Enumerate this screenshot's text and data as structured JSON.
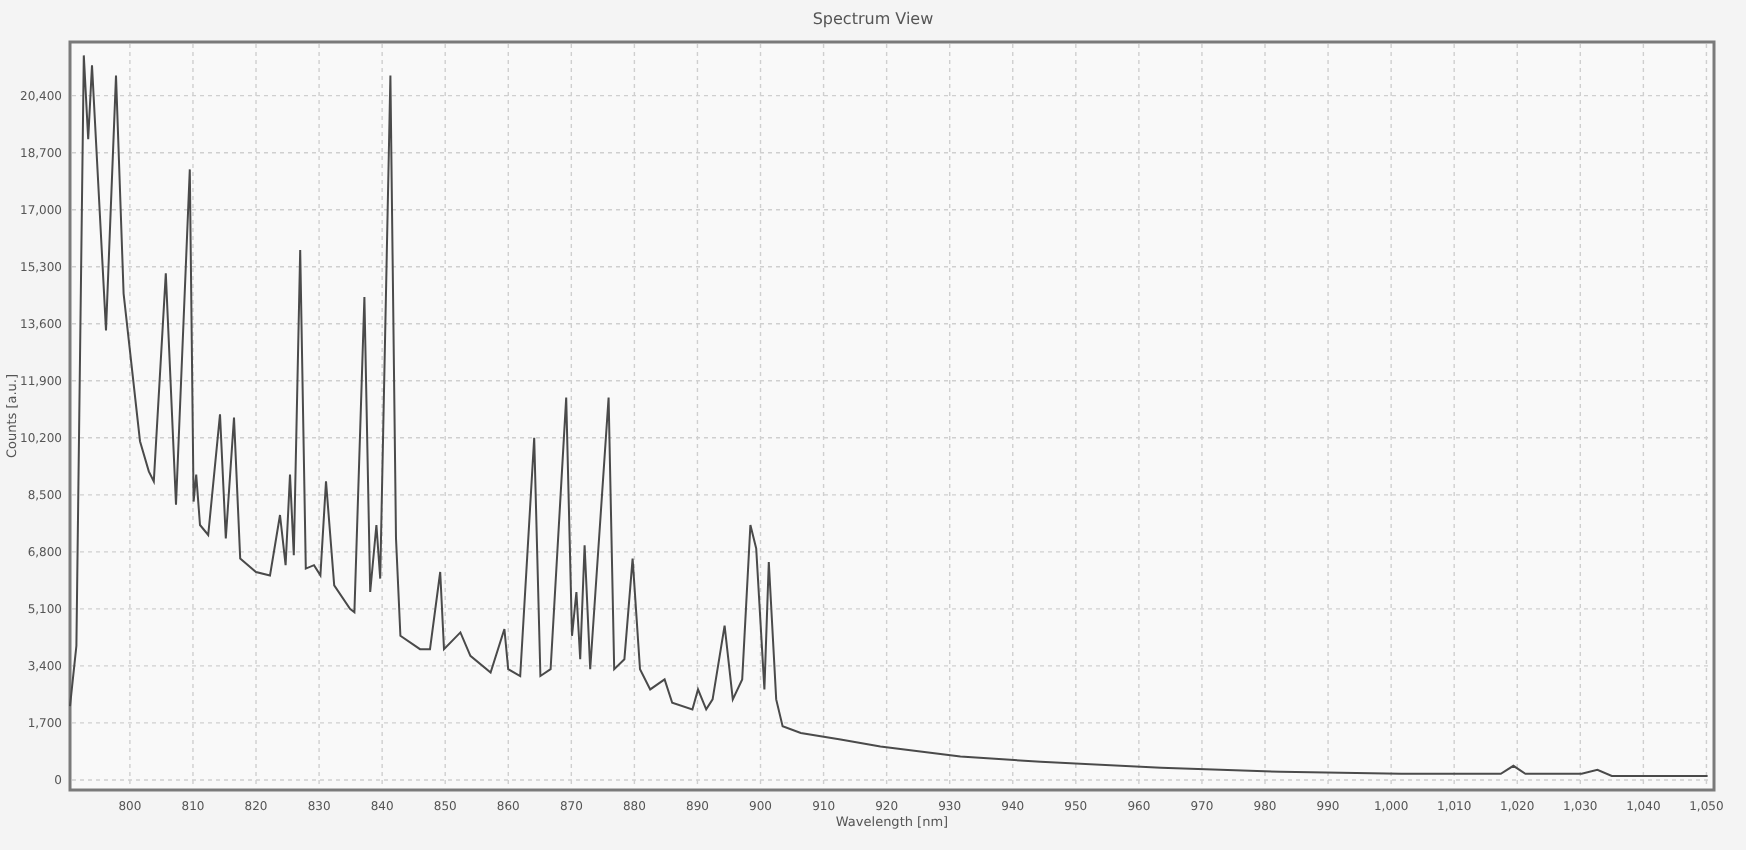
{
  "chart_data": {
    "type": "line",
    "title": "Spectrum View",
    "xlabel": "Wavelength [nm]",
    "ylabel": "Counts [a.u.]",
    "x": [
      790.5,
      791.5,
      792.7,
      793.4,
      794,
      796.2,
      797.8,
      799,
      801.6,
      803,
      803.8,
      805.7,
      807.3,
      809.5,
      810.1,
      810.5,
      811.1,
      812.4,
      814.3,
      815.2,
      816.5,
      817.5,
      820,
      822.2,
      823.8,
      824.7,
      825.4,
      826,
      827,
      827.9,
      829.2,
      830.2,
      831.1,
      832.4,
      834.9,
      835.6,
      837.2,
      838.1,
      839.1,
      839.7,
      841.3,
      842.2,
      842.9,
      846,
      847.6,
      849.2,
      849.8,
      852.4,
      854,
      857.2,
      859.4,
      860,
      861.9,
      864.1,
      865.1,
      866.7,
      869.2,
      870.1,
      870.8,
      871.4,
      872.1,
      873,
      875.9,
      876.8,
      878.4,
      879.7,
      880.9,
      882.5,
      884.8,
      886,
      889.2,
      890.1,
      891.4,
      892.4,
      894.3,
      895.6,
      897.1,
      898.4,
      899.3,
      900.6,
      901.3,
      902.5,
      903.5,
      906.4,
      912.7,
      919,
      931.7,
      944.4,
      963.5,
      982.5,
      1001.6,
      1017.4,
      1019.4,
      1021.3,
      1030.2,
      1032.7,
      1035,
      1050.2
    ],
    "grid": true,
    "series": [
      {
        "color": "#4a4a4a",
        "values": [
          2200,
          4000,
          21600,
          19100,
          21300,
          13400,
          21000,
          14500,
          10100,
          9200,
          8900,
          15100,
          8200,
          18200,
          8300,
          9100,
          7600,
          7300,
          10900,
          7200,
          10800,
          6600,
          6200,
          6100,
          7900,
          6400,
          9100,
          6700,
          15800,
          6300,
          6400,
          6100,
          8900,
          5800,
          5100,
          5000,
          14400,
          5600,
          7600,
          6000,
          21000,
          7200,
          4300,
          3900,
          3900,
          6200,
          3900,
          4400,
          3700,
          3200,
          4500,
          3300,
          3100,
          10200,
          3100,
          3300,
          11400,
          4300,
          5600,
          3600,
          7000,
          3300,
          11400,
          3300,
          3600,
          6600,
          3300,
          2700,
          3000,
          2300,
          2100,
          2700,
          2100,
          2400,
          4600,
          2400,
          3000,
          7600,
          6900,
          2700,
          6500,
          2400,
          1600,
          1400,
          1200,
          1000,
          700,
          540,
          360,
          240,
          180,
          180,
          420,
          180,
          180,
          300,
          120,
          120
        ]
      }
    ],
    "xlim": [
      790.5,
      1051.2
    ],
    "ylim": [
      -300,
      22000
    ],
    "xticks": [
      800,
      810,
      820,
      830,
      840,
      850,
      860,
      870,
      880,
      890,
      900,
      910,
      920,
      930,
      940,
      950,
      960,
      970,
      980,
      990,
      {
        "value": 1000,
        "label": "1,000"
      },
      {
        "value": 1010,
        "label": "1,010"
      },
      {
        "value": 1020,
        "label": "1,020"
      },
      {
        "value": 1030,
        "label": "1,030"
      },
      {
        "value": 1040,
        "label": "1,040"
      },
      {
        "value": 1050,
        "label": "1,050"
      }
    ],
    "yticks": [
      0,
      {
        "value": 1700,
        "label": "1,700"
      },
      {
        "value": 3400,
        "label": "3,400"
      },
      {
        "value": 5100,
        "label": "5,100"
      },
      {
        "value": 6800,
        "label": "6,800"
      },
      {
        "value": 8500,
        "label": "8,500"
      },
      {
        "value": 10200,
        "label": "10,200"
      },
      {
        "value": 11900,
        "label": "11,900"
      },
      {
        "value": 13600,
        "label": "13,600"
      },
      {
        "value": 15300,
        "label": "15,300"
      },
      {
        "value": 17000,
        "label": "17,000"
      },
      {
        "value": 18700,
        "label": "18,700"
      },
      {
        "value": 20400,
        "label": "20,400"
      }
    ]
  }
}
